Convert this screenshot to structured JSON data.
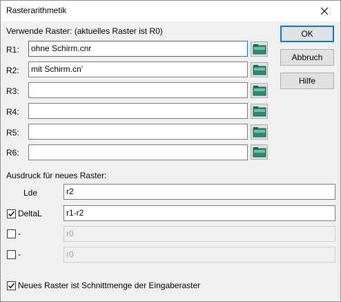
{
  "window": {
    "title": "Rasterarithmetik"
  },
  "buttons": {
    "ok": "OK",
    "cancel": "Abbruch",
    "help": "Hilfe"
  },
  "rasters": {
    "header": "Verwende Raster: (aktuelles Raster ist R0)",
    "rows": [
      {
        "label": "R1:",
        "value": "ohne Schirm.cnr"
      },
      {
        "label": "R2:",
        "value": "mit Schirm.cn’"
      },
      {
        "label": "R3:",
        "value": ""
      },
      {
        "label": "R4:",
        "value": ""
      },
      {
        "label": "R5:",
        "value": ""
      },
      {
        "label": "R6:",
        "value": ""
      }
    ]
  },
  "expression": {
    "header": "Ausdruck für neues Raster:",
    "rows": [
      {
        "label": "Lde",
        "value": "r2",
        "checkbox": null
      },
      {
        "label": "DeltaL",
        "value": "r1-r2",
        "checkbox": true
      },
      {
        "label": "-",
        "value": "r0",
        "checkbox": false
      },
      {
        "label": "-",
        "value": "r0",
        "checkbox": false
      }
    ]
  },
  "intersection": {
    "label": "Neues Raster ist Schnittmenge der Eingaberaster",
    "checked": true
  },
  "icons": {
    "close": "close-icon",
    "folder": "folder-icon",
    "check": "check-icon"
  },
  "colors": {
    "focus": "#0078d7",
    "folder_green": "#2e8b73"
  }
}
